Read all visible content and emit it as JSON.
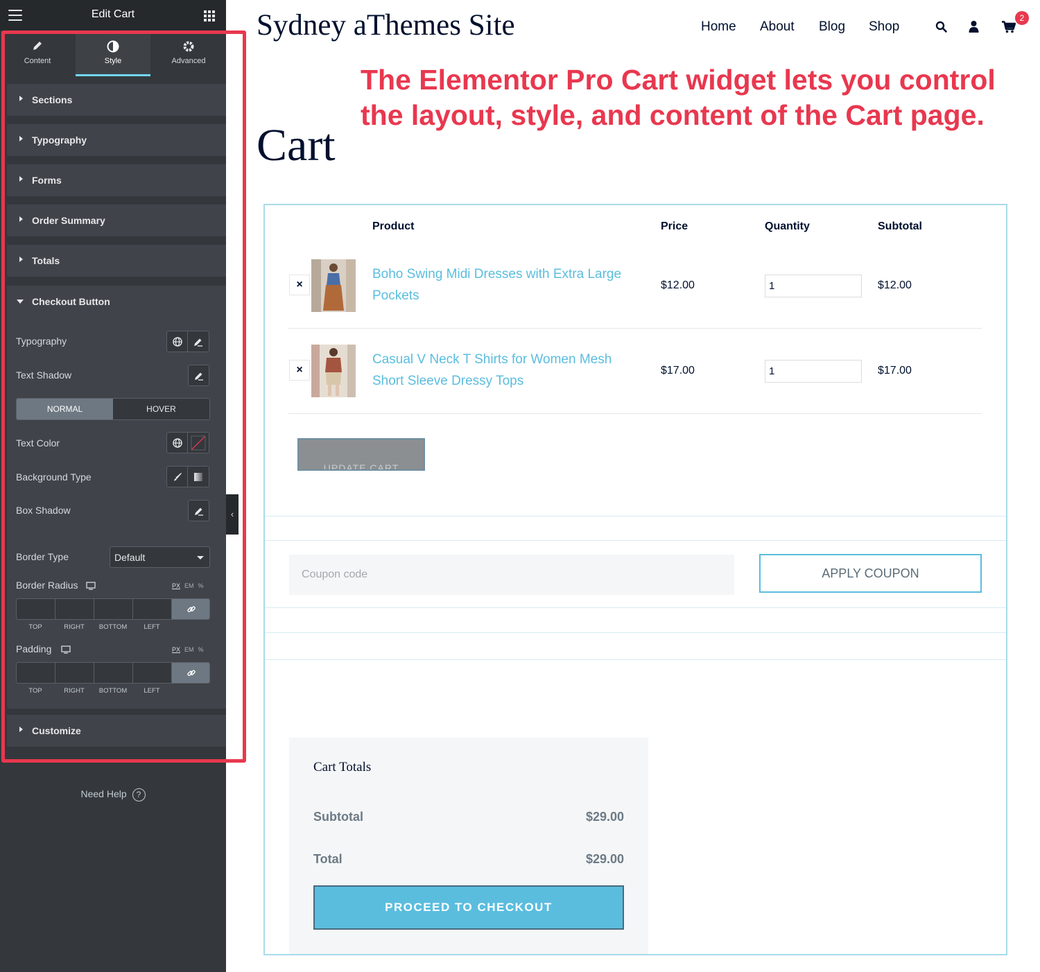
{
  "sidebar": {
    "title": "Edit Cart",
    "tabs": [
      {
        "label": "Content",
        "icon": "pencil-icon"
      },
      {
        "label": "Style",
        "icon": "half-circle-icon"
      },
      {
        "label": "Advanced",
        "icon": "gear-icon"
      }
    ],
    "active_tab": "Style",
    "sections": [
      "Sections",
      "Typography",
      "Forms",
      "Order Summary",
      "Totals"
    ],
    "open_section": "Checkout Button",
    "controls": {
      "typography": "Typography",
      "text_shadow": "Text Shadow",
      "state_normal": "NORMAL",
      "state_hover": "HOVER",
      "active_state": "NORMAL",
      "text_color": "Text Color",
      "background_type": "Background Type",
      "box_shadow": "Box Shadow",
      "border_type": "Border Type",
      "border_type_value": "Default",
      "border_radius": "Border Radius",
      "padding": "Padding",
      "units": [
        "PX",
        "EM",
        "%"
      ],
      "active_unit": "PX",
      "dimension_labels": [
        "TOP",
        "RIGHT",
        "BOTTOM",
        "LEFT"
      ]
    },
    "customize": "Customize",
    "need_help": "Need Help",
    "help_icon": "?"
  },
  "site": {
    "title": "Sydney aThemes Site",
    "nav": [
      "Home",
      "About",
      "Blog",
      "Shop"
    ],
    "cart_count": "2"
  },
  "callout": "The Elementor Pro Cart widget lets you control the layout, style, and content of the Cart page.",
  "page_heading": "Cart",
  "cart": {
    "headers": {
      "product": "Product",
      "price": "Price",
      "quantity": "Quantity",
      "subtotal": "Subtotal"
    },
    "items": [
      {
        "name": "Boho Swing Midi Dresses with Extra Large Pockets",
        "price": "$12.00",
        "qty": "1",
        "subtotal": "$12.00"
      },
      {
        "name": "Casual V Neck T Shirts for Women Mesh Short Sleeve Dressy Tops",
        "price": "$17.00",
        "qty": "1",
        "subtotal": "$17.00"
      }
    ],
    "remove_glyph": "×",
    "update_cart": "UPDATE CART",
    "coupon_placeholder": "Coupon code",
    "apply_coupon": "APPLY COUPON"
  },
  "totals": {
    "title": "Cart Totals",
    "subtotal_label": "Subtotal",
    "subtotal_value": "$29.00",
    "total_label": "Total",
    "total_value": "$29.00",
    "checkout": "PROCEED TO CHECKOUT"
  },
  "colors": {
    "accent": "#5bbdde",
    "callout_red": "#e8384f",
    "panel_dark": "#34383c",
    "tab_underline": "#71d7f7"
  }
}
